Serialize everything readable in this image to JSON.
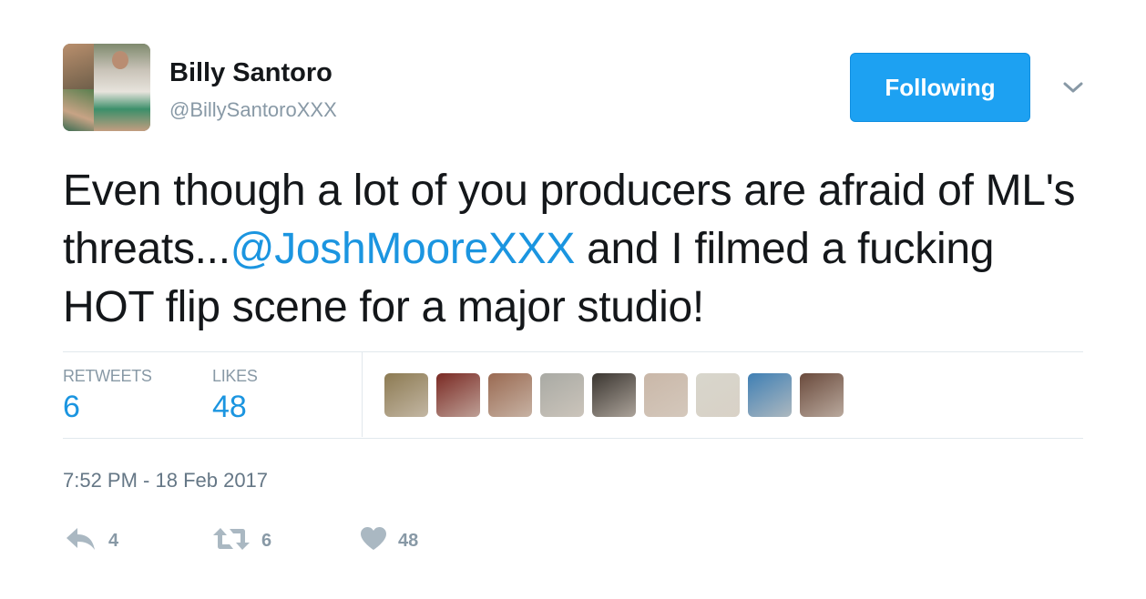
{
  "author": {
    "name": "Billy Santoro",
    "handle": "@BillySantoroXXX",
    "avatar_icon": "user-avatar-photo"
  },
  "follow_button": {
    "label": "Following",
    "color": "#1da1f2"
  },
  "menu_icon": "chevron-down-icon",
  "tweet": {
    "text_before": "Even though a lot of you producers are afraid of ML's threats...",
    "mention": "@JoshMooreXXX",
    "text_after": " and I filmed a fucking HOT flip scene for a major studio!",
    "link_color": "#1b95e0"
  },
  "stats": {
    "retweets_label": "RETWEETS",
    "retweets_count": "6",
    "likes_label": "LIKES",
    "likes_count": "48"
  },
  "likers": [
    {
      "name": "liker-1",
      "color": "#8c7a52"
    },
    {
      "name": "liker-2",
      "color": "#7a2a24"
    },
    {
      "name": "liker-3",
      "color": "#9a6a52"
    },
    {
      "name": "liker-4",
      "color": "#a9aaa4"
    },
    {
      "name": "liker-5",
      "color": "#3a3530"
    },
    {
      "name": "liker-6",
      "color": "#c9b7a8"
    },
    {
      "name": "liker-7",
      "color": "#d8d6cc"
    },
    {
      "name": "liker-8",
      "color": "#3f7fb4"
    },
    {
      "name": "liker-9",
      "color": "#6a4a3c"
    }
  ],
  "timestamp": "7:52 PM - 18 Feb 2017",
  "actions": {
    "reply_icon": "reply-icon",
    "reply_count": "4",
    "retweet_icon": "retweet-icon",
    "retweet_count": "6",
    "like_icon": "heart-icon",
    "like_count": "48"
  }
}
